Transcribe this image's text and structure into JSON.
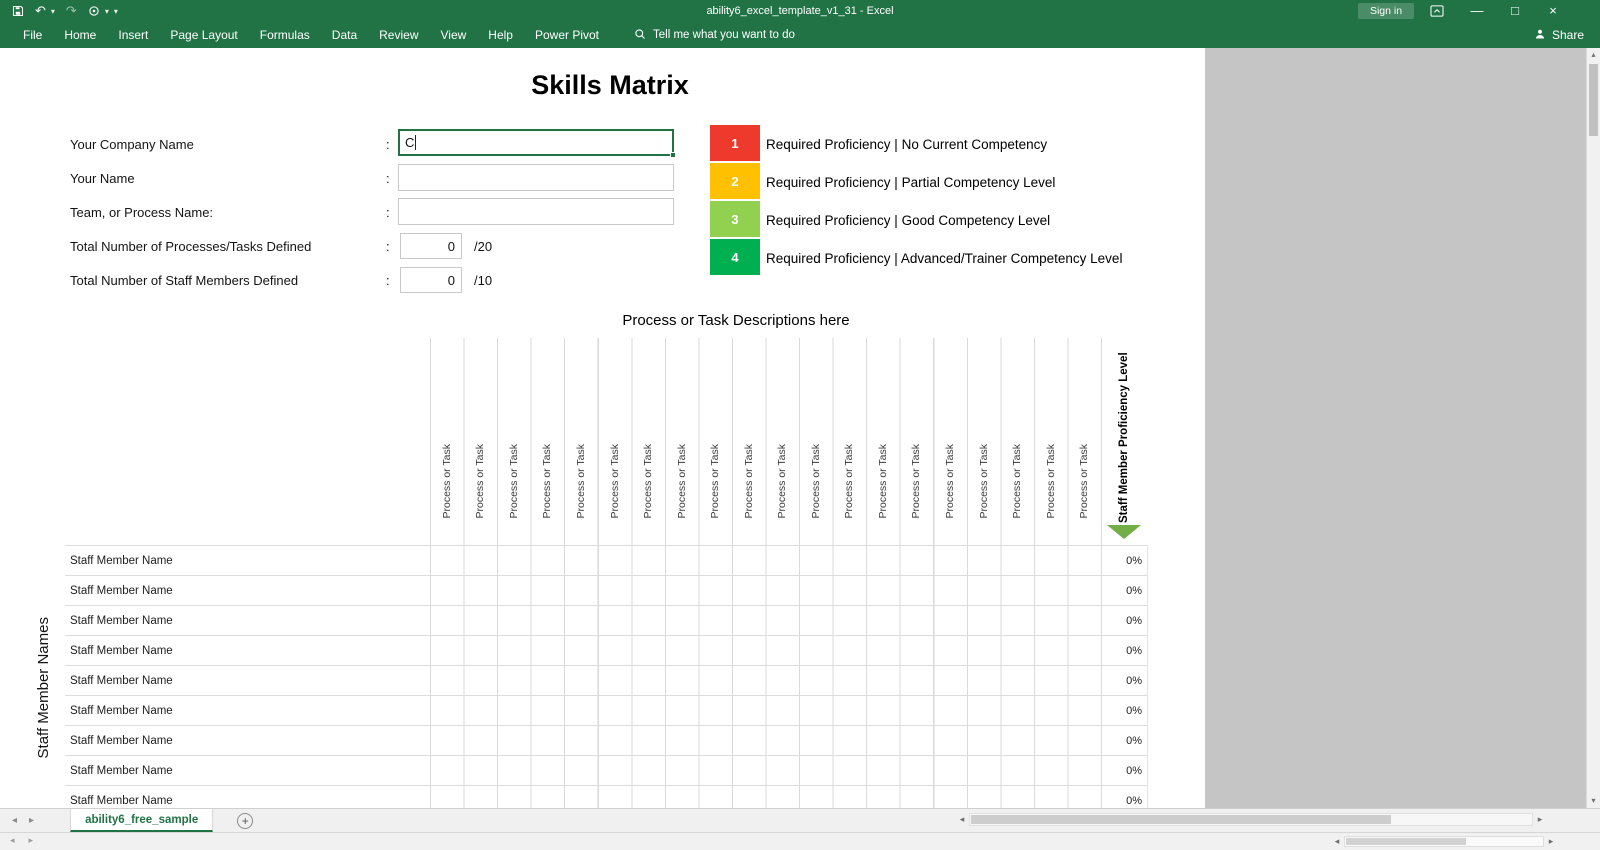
{
  "titlebar": {
    "title": "ability6_excel_template_v1_31 - Excel",
    "sign_in_label": "Sign in"
  },
  "ribbon": {
    "tabs": [
      "File",
      "Home",
      "Insert",
      "Page Layout",
      "Formulas",
      "Data",
      "Review",
      "View",
      "Help",
      "Power Pivot"
    ],
    "search_label": "Tell me what you want to do",
    "share_label": "Share"
  },
  "sheet": {
    "title": "Skills Matrix",
    "form": {
      "colon": ":",
      "rows": [
        {
          "label": "Your Company Name",
          "value": "C"
        },
        {
          "label": "Your Name",
          "value": ""
        },
        {
          "label": "Team, or Process Name:",
          "value": ""
        },
        {
          "label": "Total Number of Processes/Tasks Defined",
          "value": "0",
          "suffix": "/20"
        },
        {
          "label": "Total Number of Staff Members Defined",
          "value": "0",
          "suffix": "/10"
        }
      ]
    },
    "legend": {
      "items": [
        {
          "num": "1",
          "color": "#ee3a2c",
          "label": "Required Proficiency | No Current Competency"
        },
        {
          "num": "2",
          "color": "#ffc000",
          "label": "Required Proficiency | Partial Competency Level"
        },
        {
          "num": "3",
          "color": "#92d050",
          "label": "Required Proficiency | Good Competency Level"
        },
        {
          "num": "4",
          "color": "#00b050",
          "label": "Required Proficiency | Advanced/Trainer Competency Level"
        }
      ]
    },
    "matrix": {
      "heading": "Process or Task Descriptions here",
      "column_label": "Process or Task",
      "proficiency_label": "Staff Member Proficiency Level",
      "staff_axis_label": "Staff Member Names",
      "row_label": "Staff Member Name",
      "percent_value": "0%"
    }
  },
  "bottom": {
    "active_sheet_tab": "ability6_free_sample"
  },
  "icons": {
    "undo": "↶",
    "redo": "↷",
    "dropdown": "▾",
    "minimize": "—",
    "maximize": "□",
    "close": "×",
    "sheet_prev": "◂",
    "sheet_next": "▸",
    "scroll_left": "◂",
    "scroll_right": "▸",
    "scroll_up": "▴",
    "scroll_down": "▾",
    "add_sheet": "+"
  },
  "colors": {
    "excel_green": "#217346"
  }
}
